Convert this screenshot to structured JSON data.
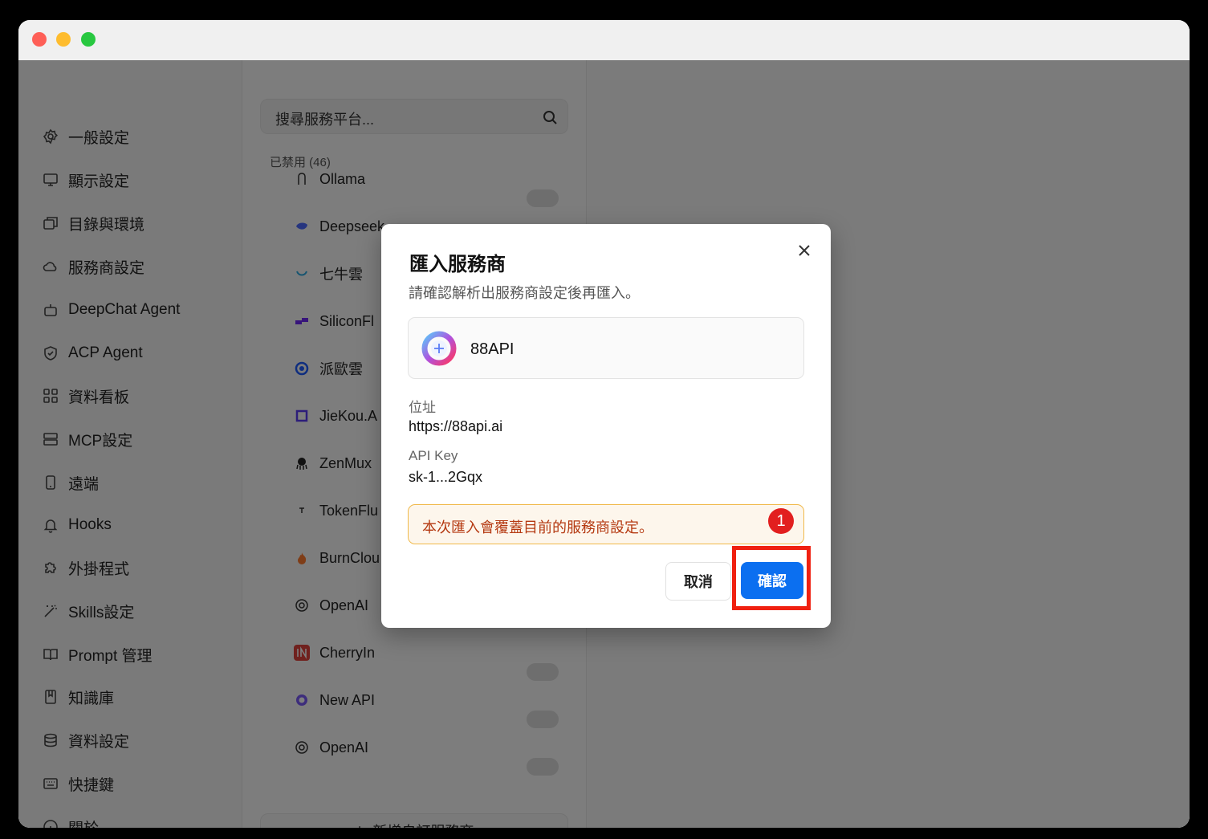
{
  "sidebar": {
    "items": [
      {
        "label": "一般設定",
        "icon": "gear-icon"
      },
      {
        "label": "顯示設定",
        "icon": "monitor-icon"
      },
      {
        "label": "目錄與環境",
        "icon": "folders-icon"
      },
      {
        "label": "服務商設定",
        "icon": "cloud-icon"
      },
      {
        "label": "DeepChat Agent",
        "icon": "robot-icon"
      },
      {
        "label": "ACP Agent",
        "icon": "shield-icon"
      },
      {
        "label": "資料看板",
        "icon": "grid-icon"
      },
      {
        "label": "MCP設定",
        "icon": "server-icon"
      },
      {
        "label": "遠端",
        "icon": "phone-icon"
      },
      {
        "label": "Hooks",
        "icon": "bell-icon"
      },
      {
        "label": "外掛程式",
        "icon": "puzzle-icon"
      },
      {
        "label": "Skills設定",
        "icon": "wand-icon"
      },
      {
        "label": "Prompt 管理",
        "icon": "book-icon"
      },
      {
        "label": "知識庫",
        "icon": "bookmark-icon"
      },
      {
        "label": "資料設定",
        "icon": "database-icon"
      },
      {
        "label": "快捷鍵",
        "icon": "keyboard-icon"
      },
      {
        "label": "關於",
        "icon": "info-icon"
      }
    ]
  },
  "providers": {
    "search_placeholder": "搜尋服務平台...",
    "group_label": "已禁用 (46)",
    "items": [
      {
        "name": "Ollama",
        "icon": "llama-icon"
      },
      {
        "name": "Deepseek",
        "icon": "whale-icon"
      },
      {
        "name": "七牛雲",
        "icon": "qiniu-icon"
      },
      {
        "name": "SiliconFl",
        "icon": "silicon-icon"
      },
      {
        "name": "派歐雲",
        "icon": "ppio-icon"
      },
      {
        "name": "JieKou.A",
        "icon": "jiekou-icon"
      },
      {
        "name": "ZenMux",
        "icon": "octopus-icon"
      },
      {
        "name": "TokenFlu",
        "icon": "tokenflux-icon"
      },
      {
        "name": "BurnClou",
        "icon": "flame-icon"
      },
      {
        "name": "OpenAI",
        "icon": "openai-icon"
      },
      {
        "name": "CherryIn",
        "icon": "cherryin-icon"
      },
      {
        "name": "New API",
        "icon": "newapi-icon"
      },
      {
        "name": "OpenAI",
        "icon": "openai-icon"
      }
    ],
    "add_label": "新增自訂服務商"
  },
  "dialog": {
    "title": "匯入服務商",
    "subtitle": "請確認解析出服務商設定後再匯入。",
    "provider_name": "88API",
    "url_label": "位址",
    "url_value": "https://88api.ai",
    "key_label": "API Key",
    "key_value": "sk-1...2Gqx",
    "warning": "本次匯入會覆蓋目前的服務商設定。",
    "badge": "1",
    "cancel_label": "取消",
    "confirm_label": "確認",
    "colors": {
      "confirm": "#0b6ff0",
      "highlight": "#f02010",
      "warning_text": "#b53a12"
    }
  }
}
